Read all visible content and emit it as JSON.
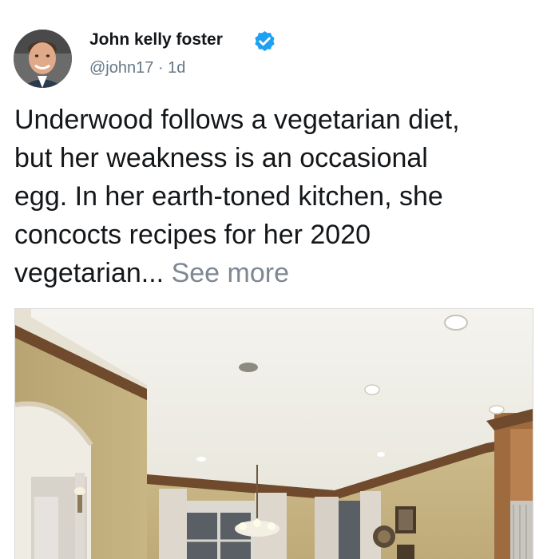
{
  "tweet": {
    "author_name": "John kelly foster",
    "verified": true,
    "handle": "@john17",
    "separator": "·",
    "time": "1d",
    "text_lines": [
      "Underwood follows a vegetarian diet,",
      "but her weakness is an occasional",
      "egg. In her earth-toned kitchen, she",
      "concocts recipes for her 2020",
      "vegetarian..."
    ],
    "see_more": "See more"
  },
  "icons": {
    "verified": "verified-badge-icon",
    "avatar": "profile-photo"
  },
  "colors": {
    "name": "#14171a",
    "meta": "#657786",
    "see_more": "#7d8892",
    "verified": "#1da1f2",
    "wall": "#c9b787",
    "ceiling": "#efeee6",
    "molding": "#6f4a2c"
  }
}
